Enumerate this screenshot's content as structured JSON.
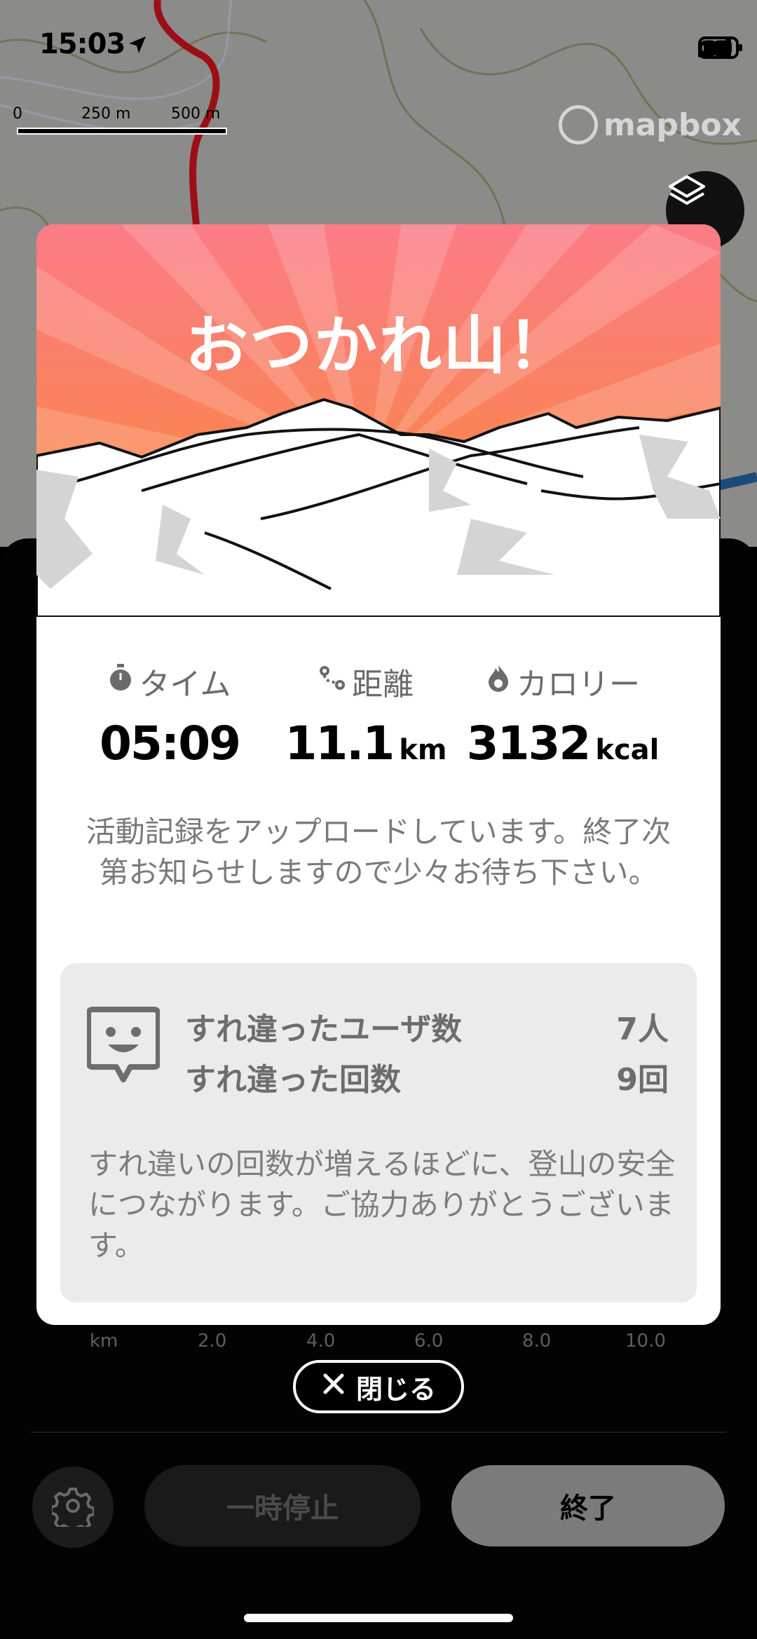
{
  "status_bar": {
    "time": "15:03"
  },
  "map": {
    "scale_labels": [
      "0",
      "250 m",
      "500 m"
    ],
    "attribution": "mapbox"
  },
  "modal": {
    "title": "おつかれ山！",
    "stats": [
      {
        "label": "タイム",
        "value": "05:09",
        "unit": "",
        "icon": "stopwatch-icon"
      },
      {
        "label": "距離",
        "value": "11.1",
        "unit": "km",
        "icon": "route-icon"
      },
      {
        "label": "カロリー",
        "value": "3132",
        "unit": "kcal",
        "icon": "flame-icon"
      }
    ],
    "upload_message": "活動記録をアップロードしています。終了次第お知らせしますので少々お待ち下さい。",
    "passings": {
      "users_label": "すれ違ったユーザ数",
      "users_value": "7人",
      "count_label": "すれ違った回数",
      "count_value": "9回",
      "note": "すれ違いの回数が増えるほどに、登山の安全につながります。ご協力ありがとうございます。"
    }
  },
  "chart_axis": [
    "km",
    "2.0",
    "4.0",
    "6.0",
    "8.0",
    "10.0"
  ],
  "close_label": "閉じる",
  "controls": {
    "pause_label": "一時停止",
    "end_label": "終了"
  },
  "colors": {
    "hero_top": "#f97d86",
    "hero_bottom": "#f98a33",
    "end_button": "#7b7b7b"
  }
}
